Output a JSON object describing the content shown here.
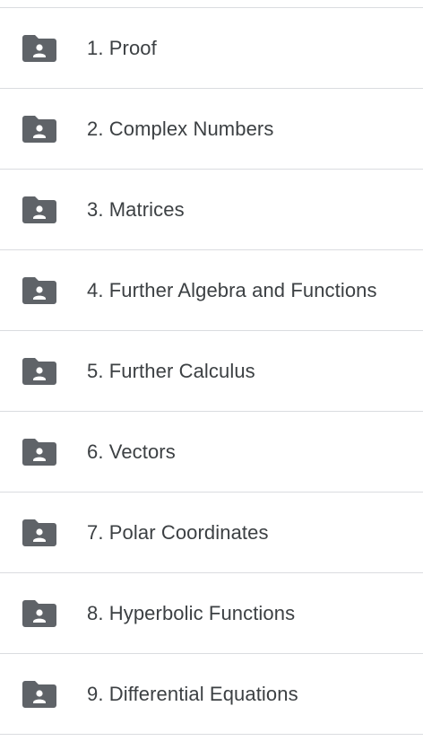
{
  "folders": [
    {
      "label": "1. Proof",
      "icon": "shared-folder-icon"
    },
    {
      "label": "2. Complex Numbers",
      "icon": "shared-folder-icon"
    },
    {
      "label": "3. Matrices",
      "icon": "shared-folder-icon"
    },
    {
      "label": "4. Further Algebra and Functions",
      "icon": "shared-folder-icon"
    },
    {
      "label": "5. Further Calculus",
      "icon": "shared-folder-icon"
    },
    {
      "label": "6. Vectors",
      "icon": "shared-folder-icon"
    },
    {
      "label": "7. Polar Coordinates",
      "icon": "shared-folder-icon"
    },
    {
      "label": "8. Hyperbolic Functions",
      "icon": "shared-folder-icon"
    },
    {
      "label": "9. Differential Equations",
      "icon": "shared-folder-icon"
    }
  ],
  "colors": {
    "icon": "#5f6368",
    "text": "#3c4043",
    "divider": "#dadce0"
  }
}
